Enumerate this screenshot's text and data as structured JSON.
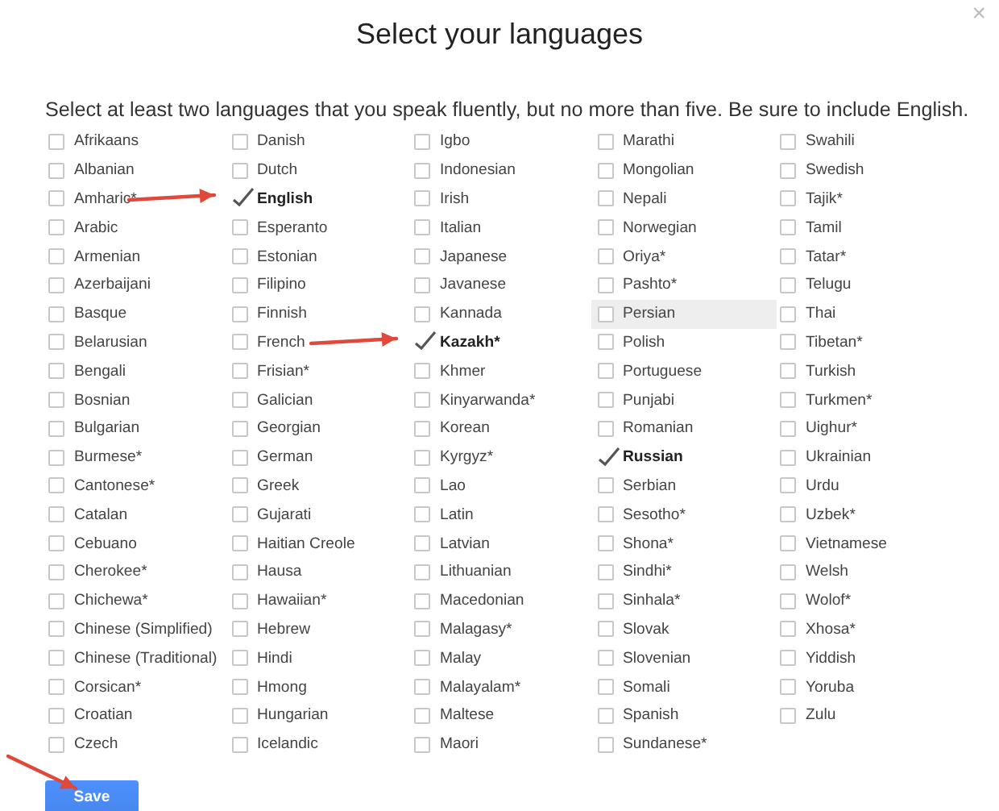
{
  "dialog": {
    "title": "Select your languages",
    "close": "×",
    "instructions": "Select at least two languages that you speak fluently, but no more than five. Be sure to include English.",
    "columns": [
      [
        {
          "label": "Afrikaans",
          "checked": false
        },
        {
          "label": "Albanian",
          "checked": false
        },
        {
          "label": "Amharic*",
          "checked": false
        },
        {
          "label": "Arabic",
          "checked": false
        },
        {
          "label": "Armenian",
          "checked": false
        },
        {
          "label": "Azerbaijani",
          "checked": false
        },
        {
          "label": "Basque",
          "checked": false
        },
        {
          "label": "Belarusian",
          "checked": false
        },
        {
          "label": "Bengali",
          "checked": false
        },
        {
          "label": "Bosnian",
          "checked": false
        },
        {
          "label": "Bulgarian",
          "checked": false
        },
        {
          "label": "Burmese*",
          "checked": false
        },
        {
          "label": "Cantonese*",
          "checked": false
        },
        {
          "label": "Catalan",
          "checked": false
        },
        {
          "label": "Cebuano",
          "checked": false
        },
        {
          "label": "Cherokee*",
          "checked": false
        },
        {
          "label": "Chichewa*",
          "checked": false
        },
        {
          "label": "Chinese (Simplified)",
          "checked": false
        },
        {
          "label": "Chinese (Traditional)",
          "checked": false
        },
        {
          "label": "Corsican*",
          "checked": false
        },
        {
          "label": "Croatian",
          "checked": false
        },
        {
          "label": "Czech",
          "checked": false
        }
      ],
      [
        {
          "label": "Danish",
          "checked": false
        },
        {
          "label": "Dutch",
          "checked": false
        },
        {
          "label": "English",
          "checked": true,
          "arrow": true
        },
        {
          "label": "Esperanto",
          "checked": false
        },
        {
          "label": "Estonian",
          "checked": false
        },
        {
          "label": "Filipino",
          "checked": false
        },
        {
          "label": "Finnish",
          "checked": false
        },
        {
          "label": "French",
          "checked": false
        },
        {
          "label": "Frisian*",
          "checked": false
        },
        {
          "label": "Galician",
          "checked": false
        },
        {
          "label": "Georgian",
          "checked": false
        },
        {
          "label": "German",
          "checked": false
        },
        {
          "label": "Greek",
          "checked": false
        },
        {
          "label": "Gujarati",
          "checked": false
        },
        {
          "label": "Haitian Creole",
          "checked": false
        },
        {
          "label": "Hausa",
          "checked": false
        },
        {
          "label": "Hawaiian*",
          "checked": false
        },
        {
          "label": "Hebrew",
          "checked": false
        },
        {
          "label": "Hindi",
          "checked": false
        },
        {
          "label": "Hmong",
          "checked": false
        },
        {
          "label": "Hungarian",
          "checked": false
        },
        {
          "label": "Icelandic",
          "checked": false
        }
      ],
      [
        {
          "label": "Igbo",
          "checked": false
        },
        {
          "label": "Indonesian",
          "checked": false
        },
        {
          "label": "Irish",
          "checked": false
        },
        {
          "label": "Italian",
          "checked": false
        },
        {
          "label": "Japanese",
          "checked": false
        },
        {
          "label": "Javanese",
          "checked": false
        },
        {
          "label": "Kannada",
          "checked": false
        },
        {
          "label": "Kazakh*",
          "checked": true,
          "arrow": true
        },
        {
          "label": "Khmer",
          "checked": false
        },
        {
          "label": "Kinyarwanda*",
          "checked": false
        },
        {
          "label": "Korean",
          "checked": false
        },
        {
          "label": "Kyrgyz*",
          "checked": false
        },
        {
          "label": "Lao",
          "checked": false
        },
        {
          "label": "Latin",
          "checked": false
        },
        {
          "label": "Latvian",
          "checked": false
        },
        {
          "label": "Lithuanian",
          "checked": false
        },
        {
          "label": "Macedonian",
          "checked": false
        },
        {
          "label": "Malagasy*",
          "checked": false
        },
        {
          "label": "Malay",
          "checked": false
        },
        {
          "label": "Malayalam*",
          "checked": false
        },
        {
          "label": "Maltese",
          "checked": false
        },
        {
          "label": "Maori",
          "checked": false
        }
      ],
      [
        {
          "label": "Marathi",
          "checked": false
        },
        {
          "label": "Mongolian",
          "checked": false
        },
        {
          "label": "Nepali",
          "checked": false
        },
        {
          "label": "Norwegian",
          "checked": false
        },
        {
          "label": "Oriya*",
          "checked": false
        },
        {
          "label": "Pashto*",
          "checked": false
        },
        {
          "label": "Persian",
          "checked": false,
          "hovered": true
        },
        {
          "label": "Polish",
          "checked": false
        },
        {
          "label": "Portuguese",
          "checked": false
        },
        {
          "label": "Punjabi",
          "checked": false
        },
        {
          "label": "Romanian",
          "checked": false
        },
        {
          "label": "Russian",
          "checked": true
        },
        {
          "label": "Serbian",
          "checked": false
        },
        {
          "label": "Sesotho*",
          "checked": false
        },
        {
          "label": "Shona*",
          "checked": false
        },
        {
          "label": "Sindhi*",
          "checked": false
        },
        {
          "label": "Sinhala*",
          "checked": false
        },
        {
          "label": "Slovak",
          "checked": false
        },
        {
          "label": "Slovenian",
          "checked": false
        },
        {
          "label": "Somali",
          "checked": false
        },
        {
          "label": "Spanish",
          "checked": false
        },
        {
          "label": "Sundanese*",
          "checked": false
        }
      ],
      [
        {
          "label": "Swahili",
          "checked": false
        },
        {
          "label": "Swedish",
          "checked": false
        },
        {
          "label": "Tajik*",
          "checked": false
        },
        {
          "label": "Tamil",
          "checked": false
        },
        {
          "label": "Tatar*",
          "checked": false
        },
        {
          "label": "Telugu",
          "checked": false
        },
        {
          "label": "Thai",
          "checked": false
        },
        {
          "label": "Tibetan*",
          "checked": false
        },
        {
          "label": "Turkish",
          "checked": false
        },
        {
          "label": "Turkmen*",
          "checked": false
        },
        {
          "label": "Uighur*",
          "checked": false
        },
        {
          "label": "Ukrainian",
          "checked": false
        },
        {
          "label": "Urdu",
          "checked": false
        },
        {
          "label": "Uzbek*",
          "checked": false
        },
        {
          "label": "Vietnamese",
          "checked": false
        },
        {
          "label": "Welsh",
          "checked": false
        },
        {
          "label": "Wolof*",
          "checked": false
        },
        {
          "label": "Xhosa*",
          "checked": false
        },
        {
          "label": "Yiddish",
          "checked": false
        },
        {
          "label": "Yoruba",
          "checked": false
        },
        {
          "label": "Zulu",
          "checked": false
        }
      ]
    ],
    "save": {
      "label": "Save",
      "arrow": true
    }
  }
}
